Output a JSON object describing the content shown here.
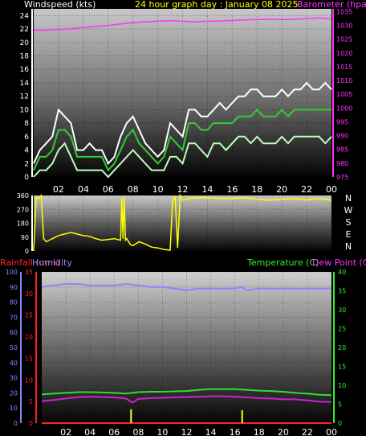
{
  "chart_data": [
    {
      "type": "line",
      "title": "24 hour graph day : January 08 2025",
      "left_axis_label": "Windspeed (kts)",
      "right_axis_label": "Barometer (hpa)",
      "x_ticks": [
        "02",
        "04",
        "06",
        "08",
        "10",
        "12",
        "14",
        "16",
        "18",
        "20",
        "22",
        "00"
      ],
      "left_ticks": [
        "0",
        "2",
        "4",
        "6",
        "8",
        "10",
        "12",
        "14",
        "16",
        "18",
        "20",
        "22",
        "24"
      ],
      "right_ticks": [
        "975",
        "980",
        "985",
        "990",
        "995",
        "1000",
        "1005",
        "1010",
        "1015",
        "1020",
        "1025",
        "1030",
        "1035"
      ],
      "ylim_left": [
        0,
        25
      ],
      "ylim_right": [
        975,
        1036
      ],
      "series": [
        {
          "name": "Barometer (hpa)",
          "color": "#ff33ff",
          "axis": "right",
          "x": [
            0,
            1,
            2,
            3,
            4,
            5,
            6,
            7,
            8,
            9,
            10,
            11,
            12,
            13,
            14,
            15,
            16,
            17,
            18,
            19,
            20,
            21,
            22,
            23,
            24
          ],
          "values": [
            1028.3,
            1028.2,
            1028.5,
            1028.8,
            1029.2,
            1029.6,
            1030.0,
            1030.5,
            1031.0,
            1031.3,
            1031.5,
            1031.7,
            1031.5,
            1031.3,
            1031.5,
            1031.6,
            1031.8,
            1032.0,
            1032.1,
            1032.2,
            1032.1,
            1032.2,
            1032.4,
            1032.7,
            1032.3
          ]
        },
        {
          "name": "Gust",
          "color": "#ffffff",
          "axis": "left",
          "x": [
            0,
            0.5,
            1,
            1.5,
            2,
            2.5,
            3,
            3.5,
            4,
            4.5,
            5,
            5.5,
            6,
            6.5,
            7,
            7.5,
            8,
            8.5,
            9,
            9.5,
            10,
            10.5,
            11,
            11.5,
            12,
            12.5,
            13,
            13.5,
            14,
            14.5,
            15,
            15.5,
            16,
            16.5,
            17,
            17.5,
            18,
            18.5,
            19,
            19.5,
            20,
            20.5,
            21,
            21.5,
            22,
            22.5,
            23,
            23.5,
            24
          ],
          "values": [
            2,
            4,
            5,
            6,
            10,
            9,
            8,
            4,
            4,
            5,
            4,
            4,
            2,
            3,
            6,
            8,
            9,
            7,
            5,
            4,
            3,
            4,
            8,
            7,
            6,
            10,
            10,
            9,
            9,
            10,
            11,
            10,
            11,
            12,
            12,
            13,
            13,
            12,
            12,
            12,
            13,
            12,
            13,
            13,
            14,
            13,
            13,
            14,
            13
          ]
        },
        {
          "name": "Wind",
          "color": "#33cc33",
          "axis": "left",
          "x": [
            0,
            0.5,
            1,
            1.5,
            2,
            2.5,
            3,
            3.5,
            4,
            4.5,
            5,
            5.5,
            6,
            6.5,
            7,
            7.5,
            8,
            8.5,
            9,
            9.5,
            10,
            10.5,
            11,
            11.5,
            12,
            12.5,
            13,
            13.5,
            14,
            14.5,
            15,
            15.5,
            16,
            16.5,
            17,
            17.5,
            18,
            18.5,
            19,
            19.5,
            20,
            20.5,
            21,
            21.5,
            22,
            22.5,
            23,
            23.5,
            24
          ],
          "values": [
            1,
            3,
            3,
            4,
            7,
            7,
            6,
            3,
            3,
            3,
            3,
            3,
            1,
            2,
            4,
            6,
            7,
            5,
            4,
            3,
            2,
            3,
            6,
            5,
            4,
            8,
            8,
            7,
            7,
            8,
            8,
            8,
            8,
            9,
            9,
            9,
            10,
            9,
            9,
            9,
            10,
            9,
            10,
            10,
            10,
            10,
            10,
            10,
            10
          ]
        },
        {
          "name": "Minimum",
          "color": "#bbffbb",
          "axis": "left",
          "x": [
            0,
            0.5,
            1,
            1.5,
            2,
            2.5,
            3,
            3.5,
            4,
            4.5,
            5,
            5.5,
            6,
            6.5,
            7,
            7.5,
            8,
            8.5,
            9,
            9.5,
            10,
            10.5,
            11,
            11.5,
            12,
            12.5,
            13,
            13.5,
            14,
            14.5,
            15,
            15.5,
            16,
            16.5,
            17,
            17.5,
            18,
            18.5,
            19,
            19.5,
            20,
            20.5,
            21,
            21.5,
            22,
            22.5,
            23,
            23.5,
            24
          ],
          "values": [
            0,
            1,
            1,
            2,
            4,
            5,
            3,
            1,
            1,
            1,
            1,
            1,
            0,
            1,
            2,
            3,
            4,
            3,
            2,
            1,
            1,
            1,
            3,
            3,
            2,
            5,
            5,
            4,
            3,
            5,
            5,
            4,
            5,
            6,
            6,
            5,
            6,
            5,
            5,
            5,
            6,
            5,
            6,
            6,
            6,
            6,
            6,
            5,
            6
          ]
        }
      ]
    },
    {
      "type": "line",
      "left_ticks": [
        "0",
        "90",
        "180",
        "270",
        "360"
      ],
      "right_ticks": [
        "N",
        "W",
        "S",
        "E",
        "N"
      ],
      "ylim": [
        0,
        360
      ],
      "series": [
        {
          "name": "Wind Direction",
          "color": "#ffff00",
          "x": [
            0,
            0.2,
            0.4,
            0.6,
            0.8,
            1,
            1.5,
            2,
            2.5,
            3,
            3.5,
            4,
            4.5,
            5,
            5.5,
            6,
            6.5,
            7,
            7.1,
            7.2,
            7.3,
            7.4,
            7.5,
            7.8,
            8,
            8.5,
            9,
            9.5,
            10,
            10.5,
            11,
            11.2,
            11.4,
            11.6,
            11.8,
            12,
            12.5,
            13,
            14,
            15,
            16,
            17,
            18,
            19,
            20,
            21,
            22,
            23,
            24
          ],
          "values": [
            0,
            350,
            340,
            360,
            80,
            60,
            80,
            100,
            110,
            120,
            110,
            100,
            95,
            80,
            70,
            75,
            80,
            70,
            340,
            80,
            350,
            70,
            80,
            40,
            35,
            60,
            45,
            25,
            20,
            10,
            5,
            330,
            350,
            20,
            360,
            330,
            340,
            345,
            345,
            340,
            340,
            345,
            335,
            330,
            335,
            340,
            330,
            340,
            330
          ]
        }
      ]
    },
    {
      "type": "line",
      "left_axis_labels": [
        "Rainfall (mm)",
        "Humidity"
      ],
      "right_axis_labels": [
        "Temperature (C)",
        "Dew Point (C)"
      ],
      "x_ticks": [
        "02",
        "04",
        "06",
        "08",
        "10",
        "12",
        "14",
        "16",
        "18",
        "20",
        "22",
        "00"
      ],
      "rain_ticks": [
        "0",
        "5",
        "10",
        "15",
        "20",
        "25",
        "30",
        "35"
      ],
      "humidity_ticks": [
        "0",
        "10",
        "20",
        "30",
        "40",
        "50",
        "60",
        "70",
        "80",
        "90",
        "100"
      ],
      "temp_ticks": [
        "0",
        "5",
        "10",
        "15",
        "20",
        "25",
        "30",
        "35",
        "40"
      ],
      "ylim_rain": [
        0,
        35
      ],
      "ylim_humidity": [
        0,
        100
      ],
      "ylim_temp": [
        0,
        40
      ],
      "series": [
        {
          "name": "Humidity",
          "color": "#8888ff",
          "axis": "humidity",
          "x": [
            0,
            1,
            2,
            3,
            4,
            5,
            6,
            7,
            8,
            9,
            10,
            11,
            12,
            13,
            14,
            15,
            16,
            16.5,
            17,
            18,
            19,
            20,
            21,
            22,
            23,
            24
          ],
          "values": [
            90,
            91,
            92,
            92,
            91,
            91,
            91,
            92,
            91,
            90,
            90,
            89,
            88,
            89,
            89,
            89,
            89,
            90,
            88,
            89,
            89,
            89,
            89,
            89,
            89,
            89
          ]
        },
        {
          "name": "Temperature (C)",
          "color": "#33dd33",
          "axis": "temp",
          "x": [
            0,
            1,
            2,
            3,
            4,
            5,
            6,
            7,
            8,
            9,
            10,
            11,
            12,
            13,
            14,
            15,
            16,
            17,
            18,
            19,
            20,
            21,
            22,
            23,
            24
          ],
          "values": [
            7.6,
            7.8,
            8.0,
            8.2,
            8.2,
            8.1,
            8.0,
            7.8,
            8.2,
            8.3,
            8.3,
            8.4,
            8.5,
            8.8,
            9.0,
            9.0,
            9.0,
            8.8,
            8.6,
            8.5,
            8.3,
            8.0,
            7.8,
            7.5,
            7.4
          ]
        },
        {
          "name": "Dew Point (C)",
          "color": "#cc22cc",
          "axis": "temp",
          "x": [
            0,
            1,
            2,
            3,
            4,
            5,
            6,
            7,
            7.5,
            8,
            9,
            10,
            11,
            12,
            13,
            14,
            15,
            16,
            17,
            18,
            19,
            20,
            21,
            22,
            23,
            24
          ],
          "values": [
            5.8,
            6.1,
            6.5,
            6.9,
            7.0,
            6.9,
            6.8,
            6.5,
            5.4,
            6.4,
            6.6,
            6.7,
            6.8,
            6.9,
            7.0,
            7.1,
            7.1,
            7.0,
            6.8,
            6.6,
            6.5,
            6.3,
            6.3,
            6.0,
            5.7,
            5.6
          ]
        },
        {
          "name": "Rainfall (mm)",
          "color": "#ff2222",
          "axis": "rain",
          "x": [
            0,
            24
          ],
          "values": [
            0,
            0
          ]
        },
        {
          "name": "Rain rate",
          "color": "#ffff00",
          "axis": "rain",
          "type": "bar",
          "x": [
            7.4,
            16.6
          ],
          "values": [
            3.2,
            3.0
          ]
        }
      ]
    }
  ]
}
